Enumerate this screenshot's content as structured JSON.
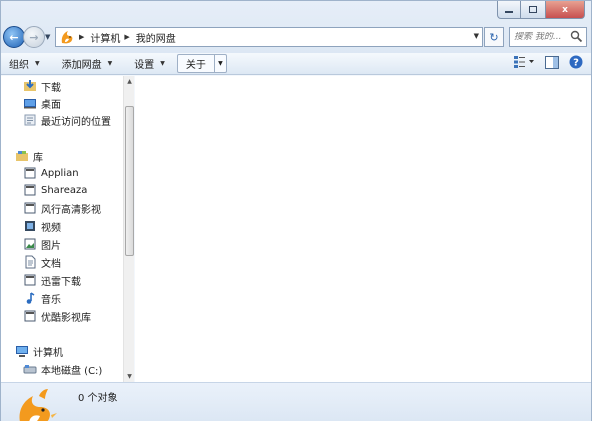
{
  "window": {
    "min_label": "",
    "max_label": "",
    "close_label": "x"
  },
  "nav": {
    "back_label": "←",
    "forward_label": "→",
    "history_dropdown": "▼",
    "refresh_label": "↻",
    "crumbs": [
      "计算机",
      "我的网盘"
    ],
    "address_dropdown": "▼",
    "search_placeholder": "搜索 我的..."
  },
  "toolbar": {
    "organize": "组织",
    "add_drive": "添加网盘",
    "settings": "设置",
    "close": "关于",
    "dropdown_glyph": "▼"
  },
  "sidebar": {
    "downloads": "下载",
    "desktop": "桌面",
    "recent": "最近访问的位置",
    "library": "库",
    "library_items": [
      "Applian",
      "Shareaza",
      "风行高清影视",
      "视频",
      "图片",
      "文档",
      "迅雷下载",
      "音乐",
      "优酷影视库"
    ],
    "computer": "计算机",
    "local_disk": "本地磁盘 (C:)"
  },
  "status": {
    "object_count": "0 个对象"
  },
  "colors": {
    "accent": "#1f62b5",
    "close_red": "#c75050"
  }
}
